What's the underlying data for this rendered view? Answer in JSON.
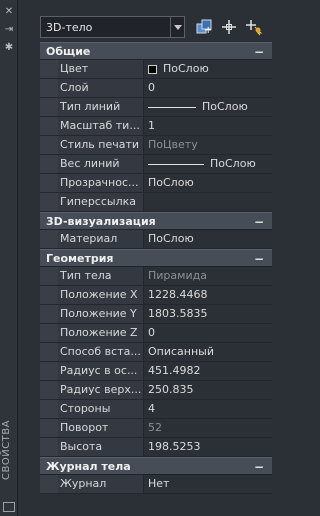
{
  "strip": {
    "title": "СВОЙСТВА",
    "icons": [
      "close-icon",
      "pin-icon",
      "settings-icon",
      "panel-icon"
    ]
  },
  "selector": {
    "value": "3D-тело"
  },
  "toolbar": {
    "icons": [
      "toggle-pickadd-icon",
      "select-objects-icon",
      "quick-select-icon"
    ]
  },
  "sections": [
    {
      "title": "Общие",
      "rows": [
        {
          "name": "Цвет",
          "value": "ПоСлою",
          "kind": "color"
        },
        {
          "name": "Слой",
          "value": "0"
        },
        {
          "name": "Тип линий",
          "value": "ПоСлою",
          "kind": "line"
        },
        {
          "name": "Масштаб ти...",
          "value": "1"
        },
        {
          "name": "Стиль печати",
          "value": "ПоЦвету",
          "dim": true
        },
        {
          "name": "Вес линий",
          "value": "ПоСлою",
          "kind": "line-long"
        },
        {
          "name": "Прозрачнос...",
          "value": "ПоСлою"
        },
        {
          "name": "Гиперссылка",
          "value": ""
        }
      ]
    },
    {
      "title": "3D-визуализация",
      "rows": [
        {
          "name": "Материал",
          "value": "ПоСлою"
        }
      ]
    },
    {
      "title": "Геометрия",
      "rows": [
        {
          "name": "Тип тела",
          "value": "Пирамида",
          "dim": true
        },
        {
          "name": "Положение X",
          "value": "1228.4468"
        },
        {
          "name": "Положение Y",
          "value": "1803.5835"
        },
        {
          "name": "Положение Z",
          "value": "0"
        },
        {
          "name": "Способ вста...",
          "value": "Описанный"
        },
        {
          "name": "Радиус в ос...",
          "value": "451.4982"
        },
        {
          "name": "Радиус верх...",
          "value": "250.835"
        },
        {
          "name": "Стороны",
          "value": "4"
        },
        {
          "name": "Поворот",
          "value": "52",
          "dim": true
        },
        {
          "name": "Высота",
          "value": "198.5253"
        }
      ]
    },
    {
      "title": "Журнал тела",
      "rows": [
        {
          "name": "Журнал",
          "value": "Нет"
        }
      ]
    }
  ]
}
